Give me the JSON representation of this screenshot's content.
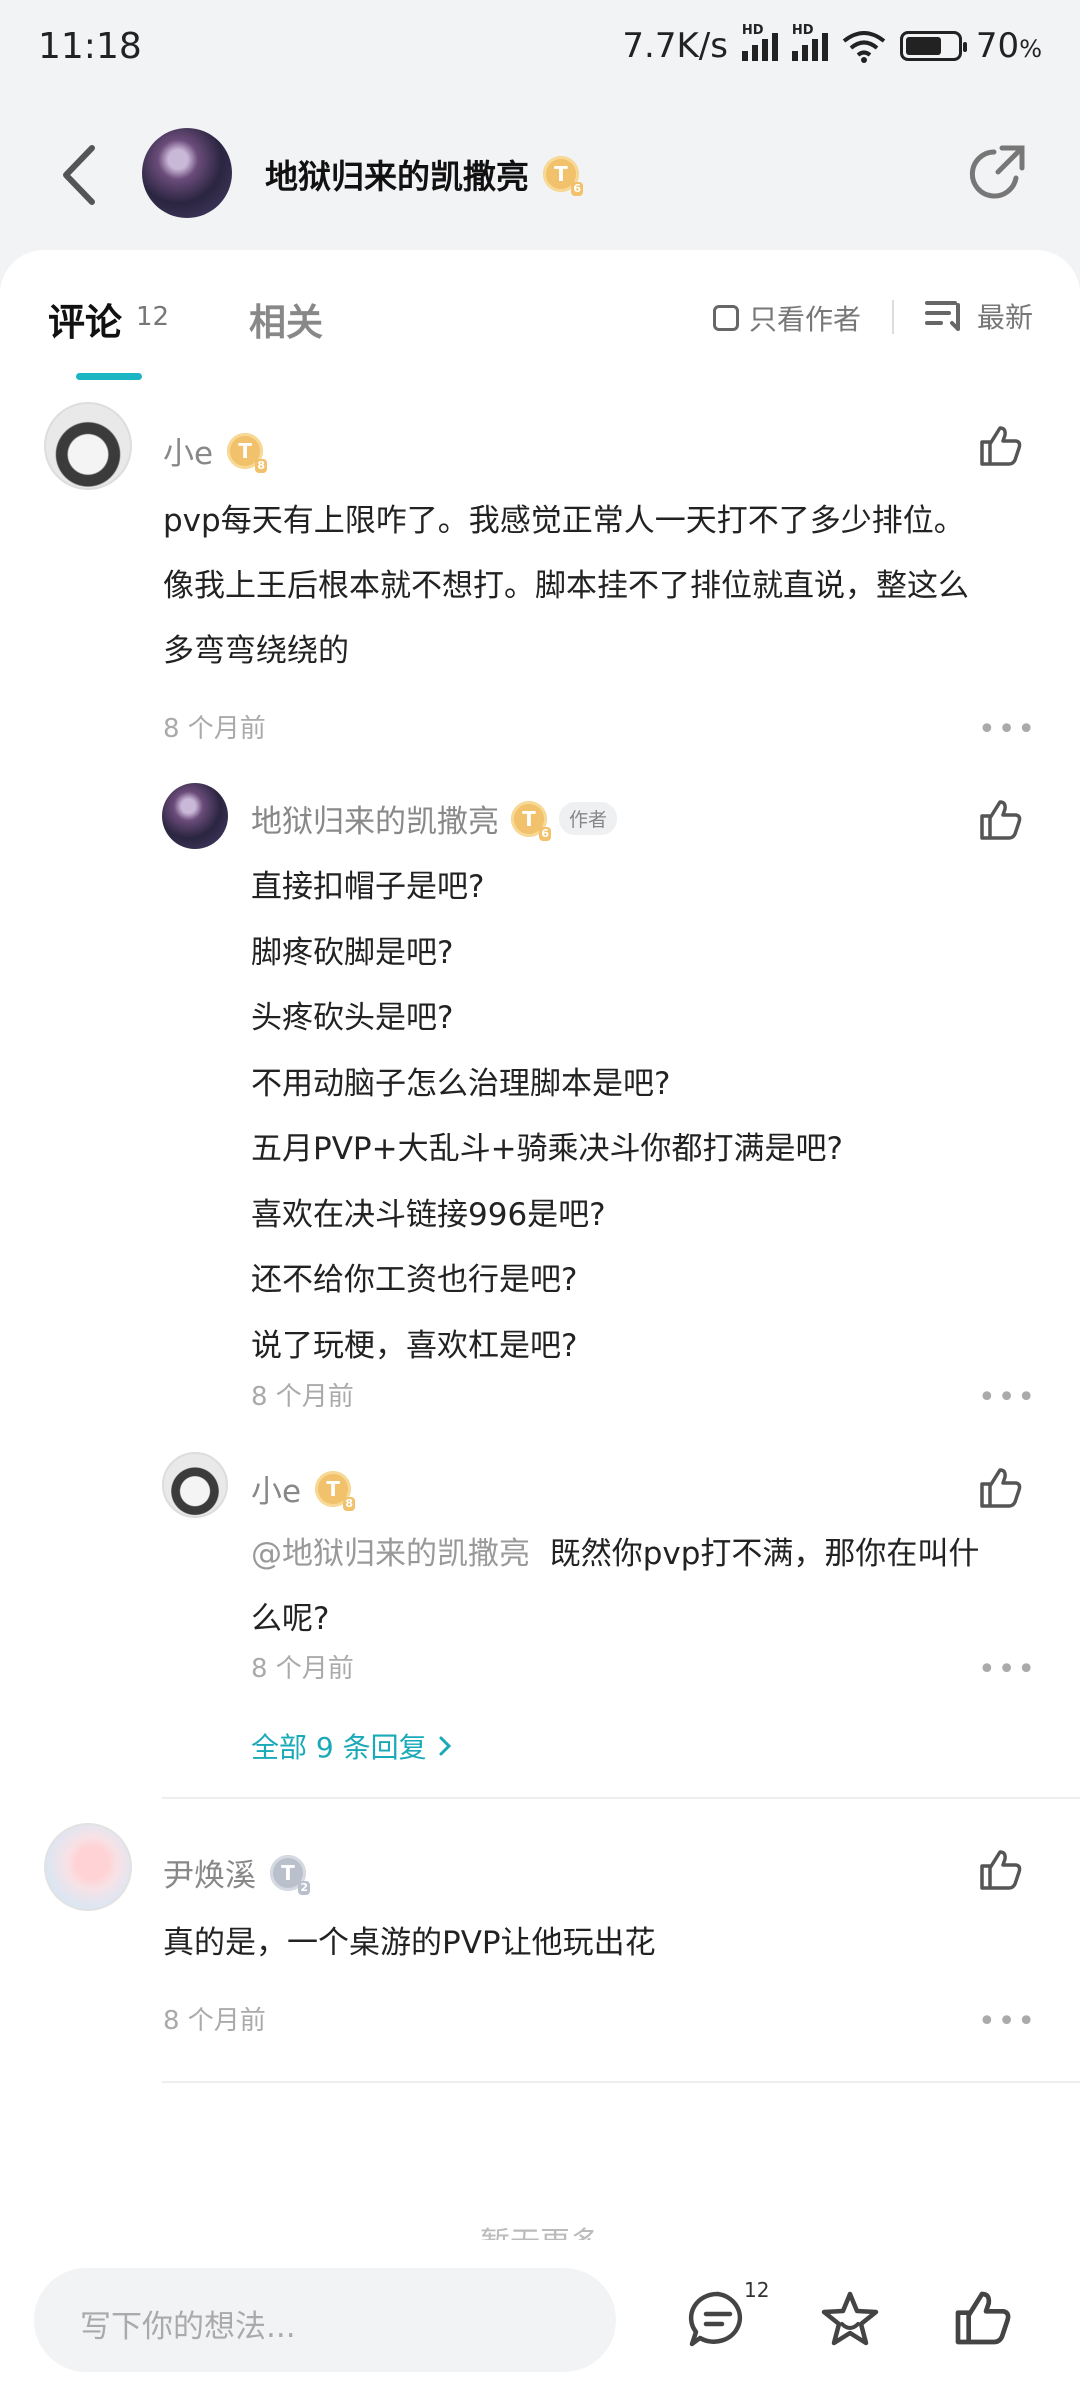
{
  "status_bar": {
    "time": "11:18",
    "net_speed": "7.7K/s",
    "battery": "70",
    "battery_unit": "%",
    "hd": "HD"
  },
  "header": {
    "title": "地狱归来的凯撒亮",
    "badge": "T",
    "badge_level": "6"
  },
  "tabs": {
    "comments_label": "评论",
    "comments_count": "12",
    "related_label": "相关"
  },
  "filters": {
    "only_author": "只看作者",
    "sort": "最新"
  },
  "comments": [
    {
      "name": "小e",
      "badge": "T",
      "badge_level": "8",
      "text_lines": [
        "pvp每天有上限咋了。我感觉正常人一天打不了多少排位。",
        "像我上王后根本就不想打。脚本挂不了排位就直说，整这么",
        "多弯弯绕绕的"
      ],
      "time": "8 个月前",
      "replies": [
        {
          "name": "地狱归来的凯撒亮",
          "badge": "T",
          "badge_level": "6",
          "tag": "作者",
          "text_lines": [
            "直接扣帽子是吧?",
            "脚疼砍脚是吧?",
            "头疼砍头是吧?",
            "不用动脑子怎么治理脚本是吧?",
            "五月PVP+大乱斗+骑乘决斗你都打满是吧?",
            "喜欢在决斗链接996是吧?",
            "还不给你工资也行是吧?",
            "说了玩梗，喜欢杠是吧?"
          ],
          "time": "8 个月前"
        },
        {
          "name": "小e",
          "badge": "T",
          "badge_level": "8",
          "mention": "@地狱归来的凯撒亮",
          "text_lines": [
            "既然你pvp打不满，那你在叫什",
            "么呢?"
          ],
          "time": "8 个月前"
        }
      ],
      "all_replies": "全部 9 条回复"
    },
    {
      "name": "尹焕溪",
      "badge": "T",
      "badge_level": "2",
      "text_lines": [
        "真的是，一个桌游的PVP让他玩出花"
      ],
      "time": "8 个月前"
    }
  ],
  "more_glyph": "•••",
  "load_more": "暂无更多",
  "bottom": {
    "input_placeholder": "写下你的想法...",
    "comment_count": "12"
  },
  "colors": {
    "accent": "#1cb5c4",
    "badge_gold": "#f1c16b",
    "badge_gray": "#b9c0cc"
  }
}
